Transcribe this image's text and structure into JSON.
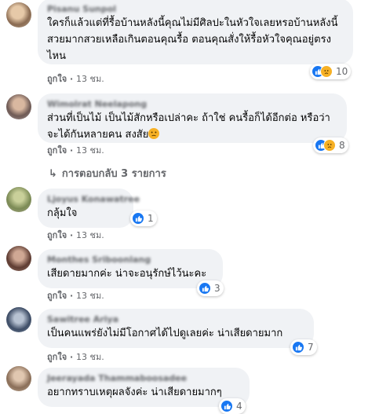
{
  "comments": [
    {
      "author": "Pisanu Sunpol",
      "text": "ใครก็แล้วแต่ที่รื้อบ้านหลังนี้คุณไม่มีศิลปะในหัวใจเลยหรอบ้านหลังนี้สวยมากสวยเหลือเกินตอนคุณรื้อ ตอนคุณสั่งให้รื้อหัวใจคุณอยู่ตรงไหน",
      "like_label": "ถูกใจ",
      "time": "13 ชม.",
      "reaction_count": "10"
    },
    {
      "author": "Wimolrat Neelapong",
      "text": "ส่วนที่เป็นไม้ เป็นไม้สักหรือเปล่าคะ ถ้าใช่ คนรื้อก็ได้อีกต่อ หรือว่าจะได้กันหลายคน สงสัย",
      "like_label": "ถูกใจ",
      "time": "13 ชม.",
      "reaction_count": "8"
    },
    {
      "author": "Ljoyus Konawatree",
      "text": "กลุ้มใจ",
      "like_label": "ถูกใจ",
      "time": "13 ชม.",
      "reaction_count": "1"
    },
    {
      "author": "Monthes Sriboonlang",
      "text": "เสียดายมากค่ะ น่าจะอนุรักษ์ไว้นะคะ",
      "like_label": "ถูกใจ",
      "time": "13 ชม.",
      "reaction_count": "3"
    },
    {
      "author": "Sawitree Ariya",
      "text": "เป็นคนแพร่ยังไม่มีโอกาศได้ไปดูเลยค่ะ น่าเสียดายมาก",
      "like_label": "ถูกใจ",
      "time": "13 ชม.",
      "reaction_count": "7"
    },
    {
      "author": "Jeerayada Thammaboosadee",
      "text": "อยากทราบเหตุผลจังค่ะ น่าเสียดายมากๆ",
      "reaction_count": "4"
    }
  ],
  "replies_link": {
    "arrow": "↳",
    "label": "การตอบกลับ 3 รายการ"
  },
  "colors": {
    "bubble": "#f0f2f5",
    "meta": "#65676b",
    "like": "#1877f2",
    "sad": "#f7b125"
  }
}
